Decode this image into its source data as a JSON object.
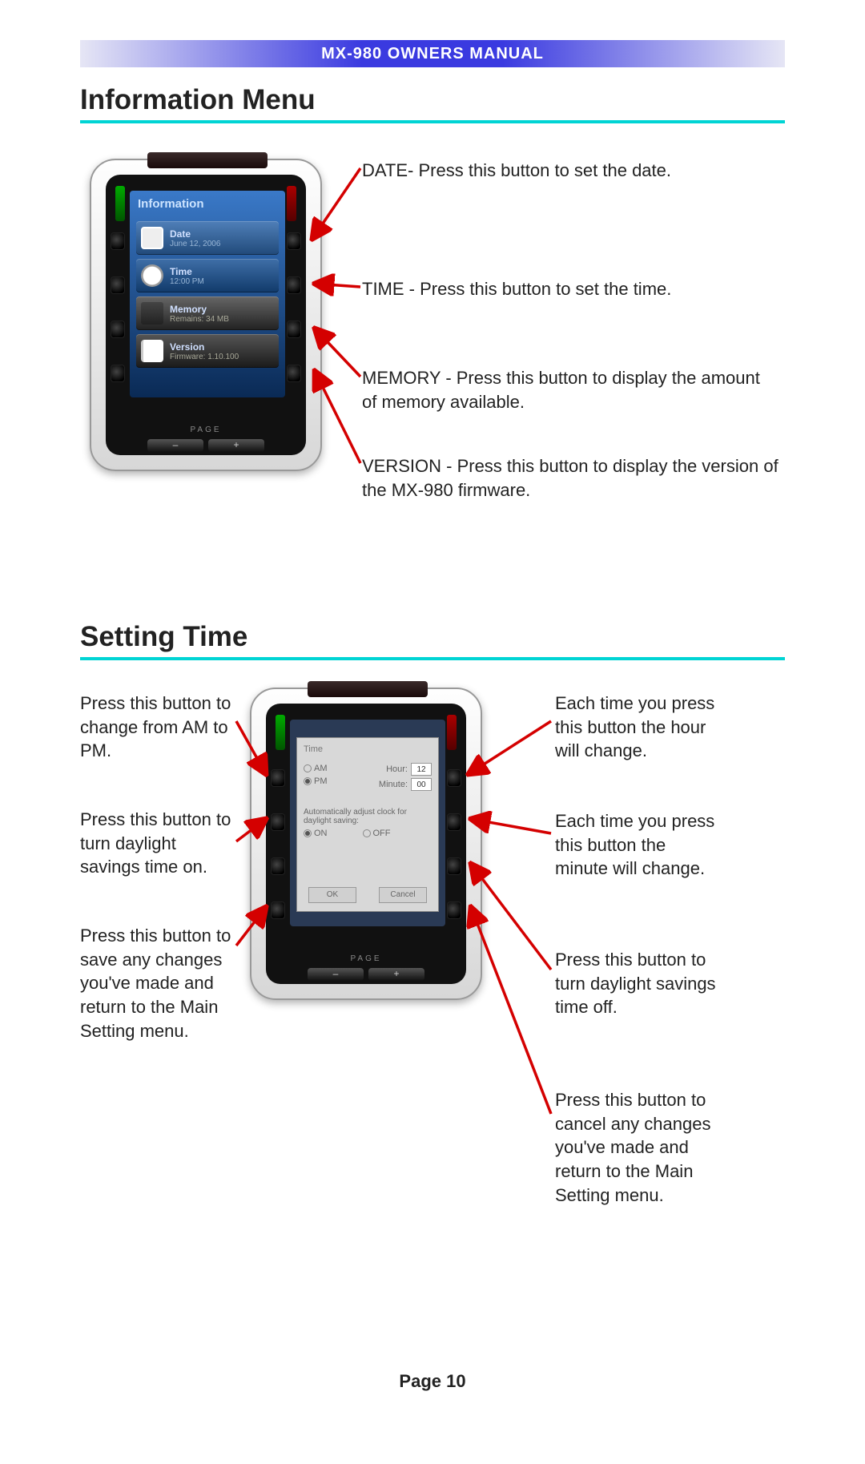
{
  "header": {
    "title_prefix": "MX-980 ",
    "title_rest": "OWNERS MANUAL"
  },
  "section1": {
    "title": "Information Menu"
  },
  "section2": {
    "title": "Setting Time"
  },
  "footer": {
    "label": "Page 10"
  },
  "device": {
    "on_label": "ON",
    "off_label": "OFF",
    "page_label": "PAGE",
    "minus": "–",
    "plus": "+"
  },
  "info_screen": {
    "header": "Information",
    "rows": [
      {
        "label": "Date",
        "sub": "June 12, 2006"
      },
      {
        "label": "Time",
        "sub": "12:00 PM"
      },
      {
        "label": "Memory",
        "sub": "Remains: 34 MB"
      },
      {
        "label": "Version",
        "sub": "Firmware: 1.10.100"
      }
    ]
  },
  "time_dialog": {
    "title": "Time",
    "am": "AM",
    "pm": "PM",
    "hour_label": "Hour:",
    "hour_value": "12",
    "minute_label": "Minute:",
    "minute_value": "00",
    "dst_prompt": "Automatically adjust clock for daylight saving:",
    "dst_on": "ON",
    "dst_off": "OFF",
    "ok": "OK",
    "cancel": "Cancel"
  },
  "callouts1": {
    "date": "DATE- Press this button to set the date.",
    "time": "TIME - Press this button to set the time.",
    "memory": "MEMORY - Press this button to display the amount of memory available.",
    "version": "VERSION - Press this button to display the version of the MX-980 firmware."
  },
  "callouts2": {
    "left1": "Press this button to change from AM to PM.",
    "left2": "Press this button to turn daylight savings time on.",
    "left3": "Press this button to save any changes you've made and return to the Main Setting menu.",
    "right1": "Each time you press this button the hour will change.",
    "right2": "Each time you press this button the minute will change.",
    "right3": "Press this button to turn daylight savings time off.",
    "right4": "Press this button to cancel any changes you've made and return to the Main Setting menu."
  }
}
